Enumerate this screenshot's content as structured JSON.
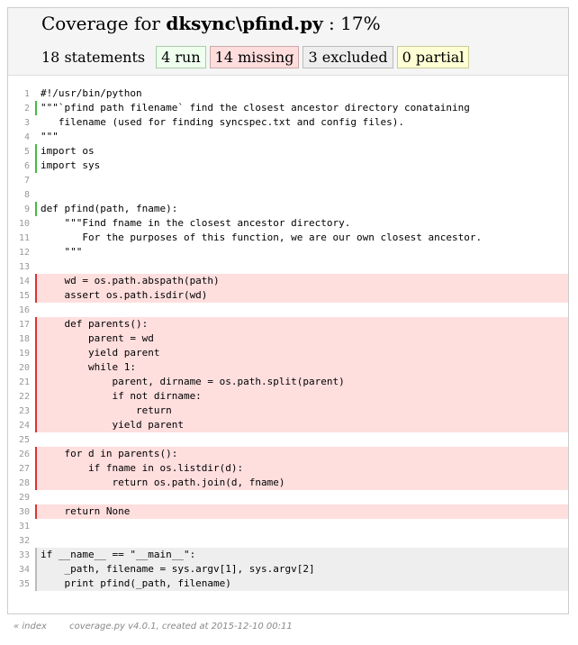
{
  "header": {
    "title_prefix": "Coverage for ",
    "title_module": "dksync\\pfind.py",
    "title_suffix": " : 17%",
    "statements": "18 statements",
    "run": "4 run",
    "missing": "14 missing",
    "excluded": "3 excluded",
    "partial": "0 partial"
  },
  "lines": [
    {
      "n": "1",
      "t": "#!/usr/bin/python",
      "s": ""
    },
    {
      "n": "2",
      "t": "\"\"\"`pfind path filename` find the closest ancestor directory conataining",
      "s": "run"
    },
    {
      "n": "3",
      "t": "   filename (used for finding syncspec.txt and config files).",
      "s": ""
    },
    {
      "n": "4",
      "t": "\"\"\"",
      "s": ""
    },
    {
      "n": "5",
      "t": "import os",
      "s": "run"
    },
    {
      "n": "6",
      "t": "import sys",
      "s": "run"
    },
    {
      "n": "7",
      "t": "",
      "s": ""
    },
    {
      "n": "8",
      "t": "",
      "s": ""
    },
    {
      "n": "9",
      "t": "def pfind(path, fname):",
      "s": "run"
    },
    {
      "n": "10",
      "t": "    \"\"\"Find fname in the closest ancestor directory.",
      "s": ""
    },
    {
      "n": "11",
      "t": "       For the purposes of this function, we are our own closest ancestor.",
      "s": ""
    },
    {
      "n": "12",
      "t": "    \"\"\"",
      "s": ""
    },
    {
      "n": "13",
      "t": "",
      "s": ""
    },
    {
      "n": "14",
      "t": "    wd = os.path.abspath(path)",
      "s": "mis"
    },
    {
      "n": "15",
      "t": "    assert os.path.isdir(wd)",
      "s": "mis"
    },
    {
      "n": "16",
      "t": "",
      "s": ""
    },
    {
      "n": "17",
      "t": "    def parents():",
      "s": "mis"
    },
    {
      "n": "18",
      "t": "        parent = wd",
      "s": "mis"
    },
    {
      "n": "19",
      "t": "        yield parent",
      "s": "mis"
    },
    {
      "n": "20",
      "t": "        while 1:",
      "s": "mis"
    },
    {
      "n": "21",
      "t": "            parent, dirname = os.path.split(parent)",
      "s": "mis"
    },
    {
      "n": "22",
      "t": "            if not dirname:",
      "s": "mis"
    },
    {
      "n": "23",
      "t": "                return",
      "s": "mis"
    },
    {
      "n": "24",
      "t": "            yield parent",
      "s": "mis"
    },
    {
      "n": "25",
      "t": "",
      "s": ""
    },
    {
      "n": "26",
      "t": "    for d in parents():",
      "s": "mis"
    },
    {
      "n": "27",
      "t": "        if fname in os.listdir(d):",
      "s": "mis"
    },
    {
      "n": "28",
      "t": "            return os.path.join(d, fname)",
      "s": "mis"
    },
    {
      "n": "29",
      "t": "",
      "s": ""
    },
    {
      "n": "30",
      "t": "    return None",
      "s": "mis"
    },
    {
      "n": "31",
      "t": "",
      "s": ""
    },
    {
      "n": "32",
      "t": "",
      "s": ""
    },
    {
      "n": "33",
      "t": "if __name__ == \"__main__\":",
      "s": "exc"
    },
    {
      "n": "34",
      "t": "    _path, filename = sys.argv[1], sys.argv[2]",
      "s": "exc"
    },
    {
      "n": "35",
      "t": "    print pfind(_path, filename)",
      "s": "exc"
    }
  ],
  "footer": {
    "index_link": "« index",
    "created": "coverage.py v4.0.1, created at 2015-12-10 00:11"
  },
  "colors": {
    "run_marker": "#44bb44",
    "missing_bg": "#ffdede",
    "missing_marker": "#dd3333",
    "excluded_bg": "#eeeeee"
  }
}
